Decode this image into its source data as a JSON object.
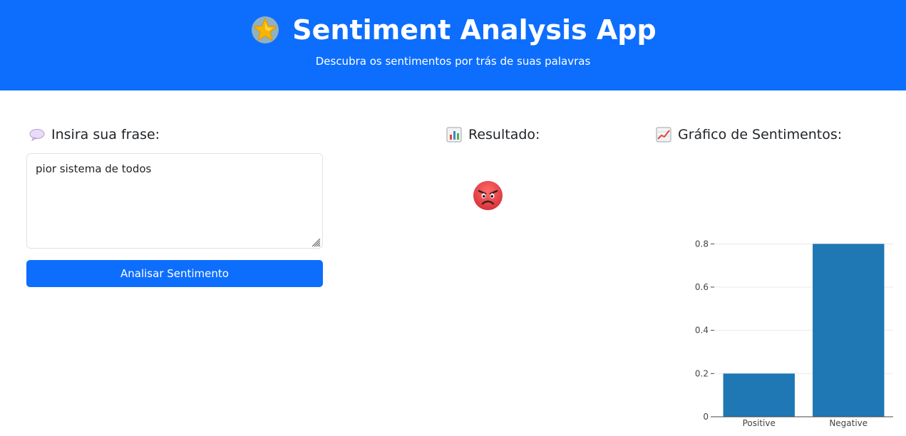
{
  "header": {
    "icon": "star-icon",
    "title": "Sentiment Analysis App",
    "subtitle": "Descubra os sentimentos por trás de suas palavras",
    "background": "#0d6efd"
  },
  "input_section": {
    "icon": "speech-bubble-icon",
    "heading": "Insira sua frase:",
    "text_value": "pior sistema de todos",
    "button_label": "Analisar Sentimento"
  },
  "result_section": {
    "icon": "bar-chart-icon",
    "heading": "Resultado:",
    "result_icon": "angry-face-icon"
  },
  "chart_section": {
    "icon": "chart-increasing-icon",
    "heading": "Gráfico de Sentimentos:"
  },
  "chart_data": {
    "type": "bar",
    "categories": [
      "Positive",
      "Negative"
    ],
    "values": [
      0.2,
      0.8
    ],
    "ylim": [
      0,
      0.9
    ],
    "yticks": [
      0,
      0.2,
      0.4,
      0.6,
      0.8
    ],
    "grid": true,
    "color": "#1f77b4"
  }
}
